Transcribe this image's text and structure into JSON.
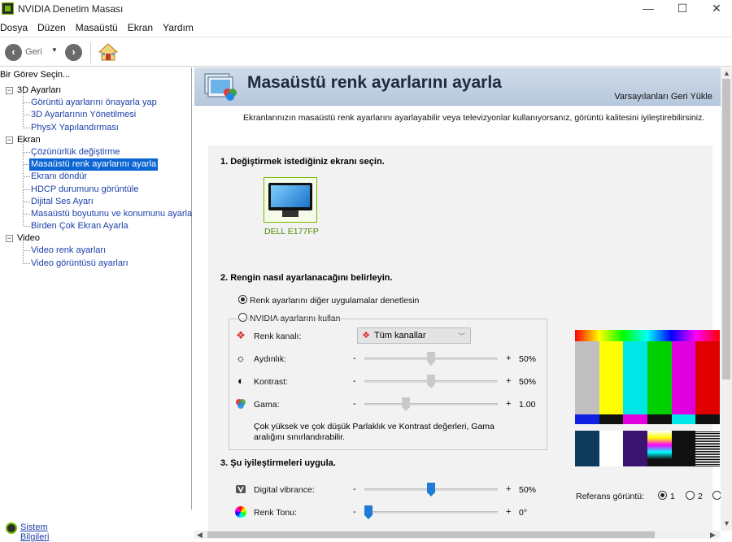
{
  "window": {
    "title": "NVIDIA Denetim Masası",
    "minimize": "—",
    "maximize": "☐",
    "close": "✕"
  },
  "menu": [
    "Dosya",
    "Düzen",
    "Masaüstü",
    "Ekran",
    "Yardım"
  ],
  "toolbar": {
    "back_label": "Geri",
    "back_icon": "arrow-left-icon",
    "forward_icon": "arrow-right-icon",
    "home_icon": "home-icon"
  },
  "sidebar": {
    "header": "Bir Görev Seçin...",
    "groups": [
      {
        "label": "3D Ayarları",
        "items": [
          "Görüntü ayarlarını önayarla yap",
          "3D Ayarlarının Yönetilmesi",
          "PhysX Yapılandırması"
        ]
      },
      {
        "label": "Ekran",
        "items": [
          "Çözünürlük değiştirme",
          "Masaüstü renk ayarlarını ayarla",
          "Ekranı döndür",
          "HDCP durumunu görüntüle",
          "Dijital Ses Ayarı",
          "Masaüstü boyutunu ve konumunu ayarla",
          "Birden Çok Ekran Ayarla"
        ]
      },
      {
        "label": "Video",
        "items": [
          "Video renk ayarları",
          "Video görüntüsü ayarları"
        ]
      }
    ],
    "selected": "Masaüstü renk ayarlarını ayarla",
    "footer_link": "Sistem Bilgileri"
  },
  "main": {
    "title": "Masaüstü renk ayarlarını ayarla",
    "restore": "Varsayılanları Geri Yükle",
    "description": "Ekranlarınızın masaüstü renk ayarlarını ayarlayabilir veya televizyonlar kullanıyorsanız, görüntü kalitesini iyileştirebilirsiniz.",
    "section1": "1. Değiştirmek istediğiniz ekranı seçin.",
    "monitor_name": "DELL E177FP",
    "section2": "2. Rengin nasıl ayarlanacağını belirleyin.",
    "radio_other": "Renk ayarlarını diğer uygulamalar denetlesin",
    "radio_nvidia": "NVIDIA ayarlarını kullan",
    "channel_label": "Renk kanalı:",
    "channel_value": "Tüm kanallar",
    "brightness": {
      "label": "Aydınlık:",
      "value": "50%",
      "level": 0.5
    },
    "contrast": {
      "label": "Kontrast:",
      "value": "50%",
      "level": 0.5
    },
    "gamma": {
      "label": "Gama:",
      "value": "1.00",
      "level": 0.3
    },
    "note": "Çok yüksek ve çok düşük Parlaklık ve Kontrast değerleri, Gama aralığını sınırlandırabilir.",
    "section3": "3. Şu iyileştirmeleri uygula.",
    "vibrance": {
      "label": "Digital vibrance:",
      "value": "50%",
      "level": 0.5
    },
    "hue": {
      "label": "Renk Tonu:",
      "value": "0°",
      "level": 0.0
    },
    "minus": "-",
    "plus": "+",
    "reference_label": "Referans görüntü:",
    "reference_options": [
      "1",
      "2",
      ""
    ]
  },
  "colors": {
    "banner_text": "#1c2b3d",
    "link": "#1b3fa8",
    "nvidia_green": "#76b900",
    "selected": "#0a64d2"
  }
}
